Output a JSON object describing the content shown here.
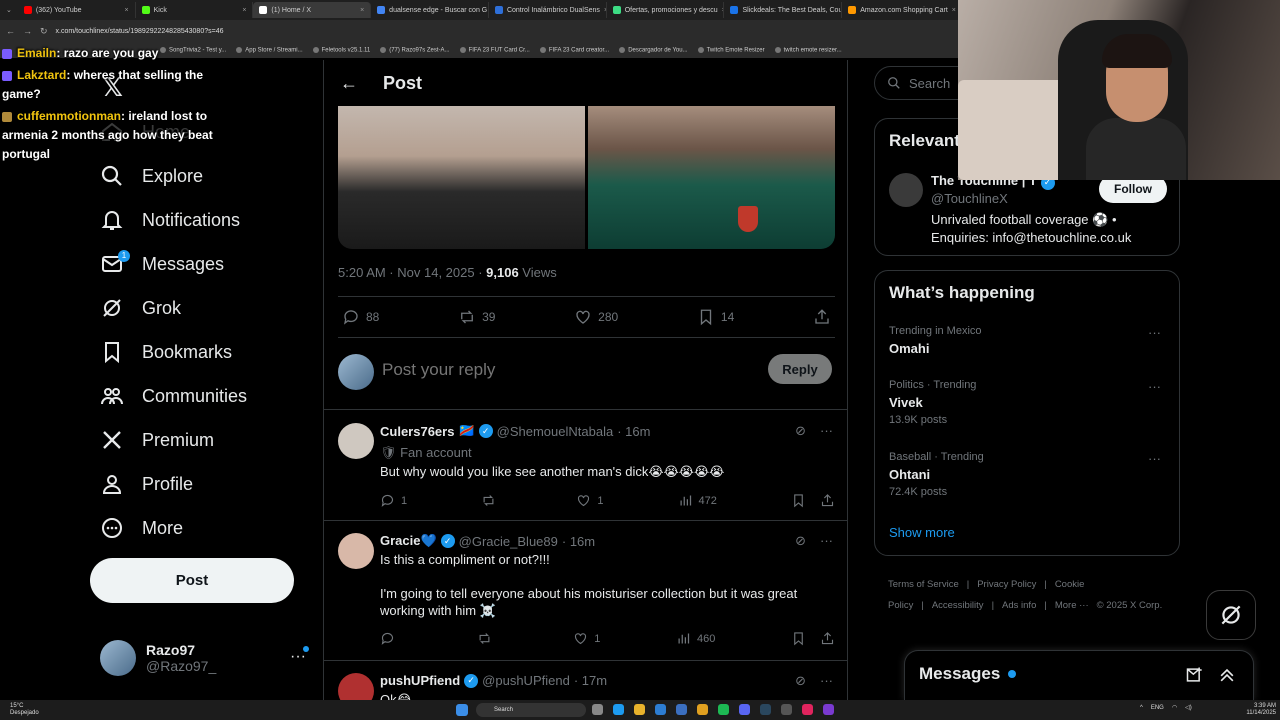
{
  "browser": {
    "tabs": [
      {
        "label": "(362) YouTube",
        "color": "#ff0000"
      },
      {
        "label": "Kick",
        "color": "#53fc18"
      },
      {
        "label": "(1) Home / X",
        "color": "#ffffff"
      },
      {
        "label": "dualsense edge - Buscar con G",
        "color": "#4285f4"
      },
      {
        "label": "Control Inalámbrico DualSens",
        "color": "#2e6fd8"
      },
      {
        "label": "Ofertas, promociones y descu",
        "color": "#3ddc84"
      },
      {
        "label": "Slickdeals: The Best Deals, Cou",
        "color": "#1a73e8"
      },
      {
        "label": "Amazon.com Shopping Cart",
        "color": "#ff9900"
      }
    ],
    "url": "x.com/touchlinex/status/1989292224828543080?s=46",
    "bookmarks": [
      "SongTrivia2 - Test y...",
      "App Store / Streami...",
      "Feletools v25.1.11",
      "(77) Razo97s Zest-A...",
      "FIFA 23 FUT Card Cr...",
      "FIFA 23 Card creator...",
      "Descargador de You...",
      "Twitch Emote Resizer",
      "twitch emote resizer..."
    ]
  },
  "chat": [
    {
      "user": "Emailn",
      "text": ": razo are you gay",
      "badge": "#7a5cff"
    },
    {
      "user": "Lakztard",
      "text": ": wheres that selling the game?",
      "badge": "#7a5cff"
    },
    {
      "user": "cuffemmotionman",
      "text": ": ireland lost to armenia 2 months ago how they beat portugal",
      "badge": "#b08a3a"
    }
  ],
  "nav": {
    "items": [
      {
        "label": "Home",
        "icon": "home-icon"
      },
      {
        "label": "Explore",
        "icon": "search-icon"
      },
      {
        "label": "Notifications",
        "icon": "bell-icon"
      },
      {
        "label": "Messages",
        "icon": "envelope-icon",
        "badge": "1"
      },
      {
        "label": "Grok",
        "icon": "grok-icon"
      },
      {
        "label": "Bookmarks",
        "icon": "bookmark-icon"
      },
      {
        "label": "Communities",
        "icon": "communities-icon"
      },
      {
        "label": "Premium",
        "icon": "x-logo-icon"
      },
      {
        "label": "Profile",
        "icon": "person-icon"
      },
      {
        "label": "More",
        "icon": "more-circle-icon"
      }
    ],
    "post_label": "Post",
    "account": {
      "name": "Razo97",
      "handle": "@Razo97_"
    }
  },
  "post": {
    "header_title": "Post",
    "time": "5:20 AM · Nov 14, 2025 · ",
    "views_count": "9,106",
    "views_label": " Views",
    "replies": "88",
    "reposts": "39",
    "likes": "280",
    "bookmarks": "14",
    "reply_placeholder": "Post your reply",
    "reply_button": "Reply"
  },
  "replies": [
    {
      "name": "Culers76ers",
      "flag": "🇨🇩",
      "handle": "@ShemouelNtabala",
      "time": "· 16m",
      "fan": "🛡 Fan account",
      "text": "But why would you like see another man's dick😭😭😭😭😭",
      "replies": "1",
      "reposts": "",
      "likes": "1",
      "views": "472",
      "avatar": "#cfc8c0"
    },
    {
      "name": "Gracie💙",
      "flag": "",
      "handle": "@Gracie_Blue89",
      "time": "· 16m",
      "fan": "",
      "text": "Is this a compliment or not?!!!\n\nI'm going to tell everyone about his moisturiser collection but it was great working with him ☠️",
      "replies": "",
      "reposts": "",
      "likes": "1",
      "views": "460",
      "avatar": "#d8b8a8"
    },
    {
      "name": "pushUPfiend",
      "flag": "",
      "handle": "@pushUPfiend",
      "time": "· 17m",
      "fan": "",
      "text": "Ok😂",
      "replies": "",
      "reposts": "",
      "likes": "",
      "views": "",
      "avatar": "#b03030"
    }
  ],
  "right": {
    "search_placeholder": "Search",
    "relevant_title": "Relevant people",
    "relevant_name": "The Touchline | T",
    "relevant_handle": "@TouchlineX",
    "relevant_bio": "Unrivaled football coverage ⚽ • Enquiries: info@thetouchline.co.uk",
    "follow_label": "Follow",
    "happening_title": "What’s happening",
    "trends": [
      {
        "context": "Trending in Mexico",
        "name": "Omahi",
        "count": ""
      },
      {
        "context": "Politics · Trending",
        "name": "Vivek",
        "count": "13.9K posts"
      },
      {
        "context": "Baseball · Trending",
        "name": "Ohtani",
        "count": "72.4K posts"
      }
    ],
    "show_more": "Show more",
    "footer": [
      "Terms of Service",
      "|",
      "Privacy Policy",
      "|",
      "Cookie Policy",
      "|",
      "Accessibility",
      "|",
      "Ads info",
      "|",
      "More ···",
      "© 2025 X Corp."
    ],
    "messages_title": "Messages"
  },
  "taskbar": {
    "weather_temp": "15°C",
    "weather_desc": "Despejado",
    "search": "Search",
    "lang": "ENG",
    "time": "3:39 AM",
    "date": "11/14/2025"
  }
}
